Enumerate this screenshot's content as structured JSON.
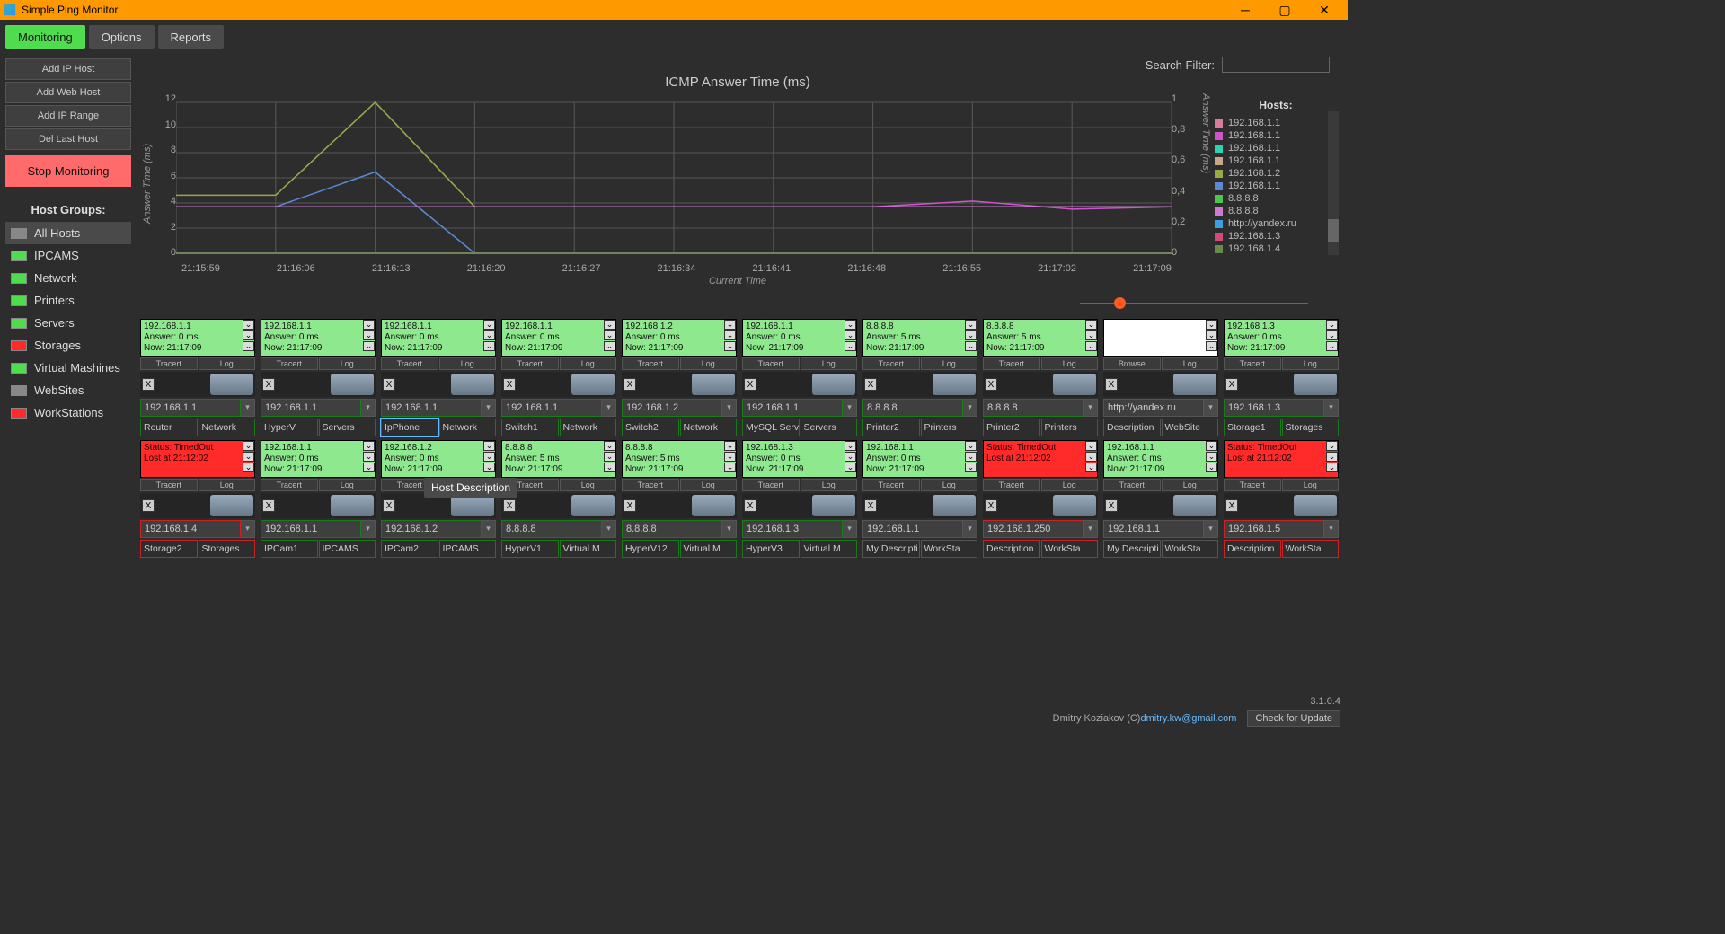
{
  "window": {
    "title": "Simple Ping Monitor"
  },
  "tabs": [
    "Monitoring",
    "Options",
    "Reports"
  ],
  "active_tab": 0,
  "toolbar": {
    "add_ip_host": "Add IP Host",
    "add_web_host": "Add Web Host",
    "add_ip_range": "Add IP Range",
    "del_last_host": "Del Last Host",
    "stop": "Stop Monitoring"
  },
  "search": {
    "label": "Search Filter:",
    "placeholder": ""
  },
  "host_groups": {
    "label": "Host Groups:",
    "items": [
      {
        "name": "All Hosts",
        "color": "#888",
        "selected": true
      },
      {
        "name": "IPCAMS",
        "color": "#4fdd4f"
      },
      {
        "name": "Network",
        "color": "#4fdd4f"
      },
      {
        "name": "Printers",
        "color": "#4fdd4f"
      },
      {
        "name": "Servers",
        "color": "#4fdd4f"
      },
      {
        "name": "Storages",
        "color": "#ff2a2a"
      },
      {
        "name": "Virtual Mashines",
        "color": "#4fdd4f"
      },
      {
        "name": "WebSites",
        "color": "#888"
      },
      {
        "name": "WorkStations",
        "color": "#ff2a2a"
      }
    ]
  },
  "chart_data": {
    "type": "line",
    "title": "ICMP Answer Time (ms)",
    "xlabel": "Current Time",
    "ylabel_left": "Answer Time (ms)",
    "ylabel_right": "Answer Time (ms)",
    "ylim_left": [
      0,
      13
    ],
    "ylim_right": [
      0,
      1
    ],
    "yticks_left": [
      0,
      2,
      4,
      6,
      8,
      10,
      12
    ],
    "yticks_right": [
      0,
      0.2,
      0.4,
      0.6,
      0.8,
      1
    ],
    "x": [
      "21:15:59",
      "21:16:06",
      "21:16:13",
      "21:16:20",
      "21:16:27",
      "21:16:34",
      "21:16:41",
      "21:16:48",
      "21:16:55",
      "21:17:02",
      "21:17:09"
    ],
    "series": [
      {
        "name": "192.168.1.1",
        "color": "#d97b9a",
        "values": [
          4,
          4,
          4,
          4,
          4,
          4,
          4,
          4,
          4,
          4,
          4
        ]
      },
      {
        "name": "192.168.1.1",
        "color": "#cc55cc",
        "values": [
          4,
          4,
          4,
          4,
          4,
          4,
          4,
          4,
          4.5,
          3.8,
          4
        ]
      },
      {
        "name": "192.168.1.1",
        "color": "#2ad4b0",
        "values": [
          4,
          4,
          4,
          4,
          4,
          4,
          4,
          4,
          4,
          4,
          4
        ]
      },
      {
        "name": "192.168.1.1",
        "color": "#c9a68a",
        "values": [
          4,
          4,
          4,
          4,
          4,
          4,
          4,
          4,
          4,
          4,
          4
        ]
      },
      {
        "name": "192.168.1.2",
        "color": "#9aa84a",
        "values": [
          5,
          5,
          13,
          4,
          4,
          4,
          4,
          4,
          4,
          4,
          4
        ]
      },
      {
        "name": "192.168.1.1",
        "color": "#5a8ad4",
        "values": [
          4,
          4,
          7,
          0,
          0,
          0,
          0,
          0,
          0,
          0,
          0
        ]
      },
      {
        "name": "8.8.8.8",
        "color": "#4fc44f",
        "values": [
          0,
          0,
          0,
          0,
          0,
          0,
          0,
          0,
          0,
          0,
          0
        ]
      },
      {
        "name": "8.8.8.8",
        "color": "#cc7ad4",
        "values": [
          4,
          4,
          4,
          4,
          4,
          4,
          4,
          4,
          4,
          4,
          4
        ]
      },
      {
        "name": "http://yandex.ru",
        "color": "#3aa0e0",
        "values": [
          0,
          0,
          0,
          0,
          0,
          0,
          0,
          0,
          0,
          0,
          0
        ]
      },
      {
        "name": "192.168.1.3",
        "color": "#d44a7a",
        "values": [
          0,
          0,
          0,
          0,
          0,
          0,
          0,
          0,
          0,
          0,
          0
        ]
      },
      {
        "name": "192.168.1.4",
        "color": "#6a8a4a",
        "values": [
          0,
          0,
          0,
          0,
          0,
          0,
          0,
          0,
          0,
          0,
          0
        ]
      }
    ]
  },
  "legend_title": "Hosts:",
  "hosts": [
    {
      "ip": "192.168.1.1",
      "status": "ok",
      "answer": "0 ms",
      "now": "21:17:09",
      "ip_sel": "192.168.1.1",
      "lbl1": "Router",
      "lbl2": "Network",
      "border": "green"
    },
    {
      "ip": "192.168.1.1",
      "status": "ok",
      "answer": "0 ms",
      "now": "21:17:09",
      "ip_sel": "192.168.1.1",
      "lbl1": "HyperV",
      "lbl2": "Servers",
      "border": "green"
    },
    {
      "ip": "192.168.1.1",
      "status": "ok",
      "answer": "0 ms",
      "now": "21:17:09",
      "ip_sel": "192.168.1.1",
      "lbl1": "IpPhone",
      "lbl2": "Network",
      "border": "green",
      "active": true
    },
    {
      "ip": "192.168.1.1",
      "status": "ok",
      "answer": "0 ms",
      "now": "21:17:09",
      "ip_sel": "192.168.1.1",
      "lbl1": "Switch1",
      "lbl2": "Network",
      "border": "green"
    },
    {
      "ip": "192.168.1.2",
      "status": "ok",
      "answer": "0 ms",
      "now": "21:17:09",
      "ip_sel": "192.168.1.2",
      "lbl1": "Switch2",
      "lbl2": "Network",
      "border": "green"
    },
    {
      "ip": "192.168.1.1",
      "status": "ok",
      "answer": "0 ms",
      "now": "21:17:09",
      "ip_sel": "192.168.1.1",
      "lbl1": "MySQL Serv",
      "lbl2": "Servers",
      "border": "green"
    },
    {
      "ip": "8.8.8.8",
      "status": "ok",
      "answer": "5 ms",
      "now": "21:17:09",
      "ip_sel": "8.8.8.8",
      "lbl1": "Printer2",
      "lbl2": "Printers",
      "border": "green"
    },
    {
      "ip": "8.8.8.8",
      "status": "ok",
      "answer": "5 ms",
      "now": "21:17:09",
      "ip_sel": "8.8.8.8",
      "lbl1": "Printer2",
      "lbl2": "Printers",
      "border": "green"
    },
    {
      "ip": "",
      "status": "web",
      "answer": "",
      "now": "",
      "ip_sel": "http://yandex.ru",
      "lbl1": "Description",
      "lbl2": "WebSite",
      "border": "plain",
      "web": true
    },
    {
      "ip": "192.168.1.3",
      "status": "ok",
      "answer": "0 ms",
      "now": "21:17:09",
      "ip_sel": "192.168.1.3",
      "lbl1": "Storage1",
      "lbl2": "Storages",
      "border": "green"
    },
    {
      "ip": "",
      "status": "bad",
      "err": "Status: TimedOut",
      "lost": "Lost at 21:12:02",
      "ip_sel": "192.168.1.4",
      "lbl1": "Storage2",
      "lbl2": "Storages",
      "border": "red"
    },
    {
      "ip": "192.168.1.1",
      "status": "ok",
      "answer": "0 ms",
      "now": "21:17:09",
      "ip_sel": "192.168.1.1",
      "lbl1": "IPCam1",
      "lbl2": "IPCAMS",
      "border": "green"
    },
    {
      "ip": "192.168.1.2",
      "status": "ok",
      "answer": "0 ms",
      "now": "21:17:09",
      "ip_sel": "192.168.1.2",
      "lbl1": "IPCam2",
      "lbl2": "IPCAMS",
      "border": "green"
    },
    {
      "ip": "8.8.8.8",
      "status": "ok",
      "answer": "5 ms",
      "now": "21:17:09",
      "ip_sel": "8.8.8.8",
      "lbl1": "HyperV1",
      "lbl2": "Virtual M",
      "border": "green"
    },
    {
      "ip": "8.8.8.8",
      "status": "ok",
      "answer": "5 ms",
      "now": "21:17:09",
      "ip_sel": "8.8.8.8",
      "lbl1": "HyperV12",
      "lbl2": "Virtual M",
      "border": "green"
    },
    {
      "ip": "192.168.1.3",
      "status": "ok",
      "answer": "0 ms",
      "now": "21:17:09",
      "ip_sel": "192.168.1.3",
      "lbl1": "HyperV3",
      "lbl2": "Virtual M",
      "border": "green"
    },
    {
      "ip": "192.168.1.1",
      "status": "ok",
      "answer": "0 ms",
      "now": "21:17:09",
      "ip_sel": "192.168.1.1",
      "lbl1": "My Descripti",
      "lbl2": "WorkSta",
      "border": "plain"
    },
    {
      "ip": "",
      "status": "bad",
      "err": "Status: TimedOut",
      "lost": "Lost at 21:12:02",
      "ip_sel": "192.168.1.250",
      "lbl1": "Description",
      "lbl2": "WorkSta",
      "border": "red"
    },
    {
      "ip": "192.168.1.1",
      "status": "ok",
      "answer": "0 ms",
      "now": "21:17:09",
      "ip_sel": "192.168.1.1",
      "lbl1": "My Descripti",
      "lbl2": "WorkSta",
      "border": "plain"
    },
    {
      "ip": "",
      "status": "bad",
      "err": "Status: TimedOut",
      "lost": "Lost at 21:12:02",
      "ip_sel": "192.168.1.5",
      "lbl1": "Description",
      "lbl2": "WorkSta",
      "border": "red"
    }
  ],
  "tooltip": "Host Description",
  "card_labels": {
    "answer": "Answer: ",
    "now": "Now: ",
    "tracert": "Tracert",
    "log": "Log",
    "browse": "Browse"
  },
  "footer": {
    "version": "3.1.0.4",
    "author": "Dmitry Koziakov (C) ",
    "email": "dmitry.kw@gmail.com",
    "update": "Check for Update"
  }
}
